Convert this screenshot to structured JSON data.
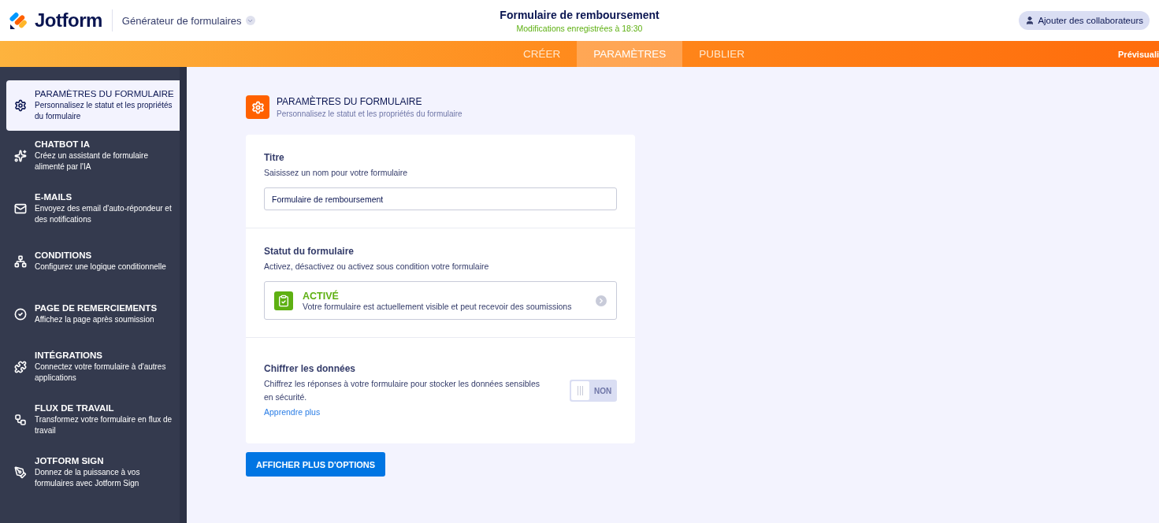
{
  "header": {
    "brand": "Jotform",
    "product_menu": "Générateur de formulaires",
    "title": "Formulaire de remboursement",
    "save_status": "Modifications enregistrées à 18:30",
    "collaborators_button": "Ajouter des collaborateurs"
  },
  "nav_tabs": [
    {
      "label": "CRÉER",
      "selected": false
    },
    {
      "label": "PARAMÈTRES",
      "selected": true
    },
    {
      "label": "PUBLIER",
      "selected": false
    }
  ],
  "preview_button": "Prévisuali",
  "sidebar": {
    "items": [
      {
        "title": "PARAMÈTRES DU FORMULAIRE",
        "description": "Personnalisez le statut et les propriétés du formulaire",
        "selected": true
      },
      {
        "title": "CHATBOT IA",
        "description": "Créez un assistant de formulaire alimenté par l'IA",
        "selected": false
      },
      {
        "title": "E-MAILS",
        "description": "Envoyez des email d'auto-répondeur et des notifications",
        "selected": false
      },
      {
        "title": "CONDITIONS",
        "description": "Configurez une logique conditionnelle",
        "selected": false
      },
      {
        "title": "PAGE DE REMERCIEMENTS",
        "description": "Affichez la page après soumission",
        "selected": false
      },
      {
        "title": "INTÉGRATIONS",
        "description": "Connectez votre formulaire à d'autres applications",
        "selected": false
      },
      {
        "title": "FLUX DE TRAVAIL",
        "description": "Transformez votre formulaire en flux de travail",
        "selected": false
      },
      {
        "title": "JOTFORM SIGN",
        "description": "Donnez de la puissance à vos formulaires avec Jotform Sign",
        "selected": false
      }
    ]
  },
  "section": {
    "title": "PARAMÈTRES DU FORMULAIRE",
    "subtitle": "Personnalisez le statut et les propriétés du formulaire"
  },
  "settings": [
    {
      "kind": "text",
      "label": "Titre",
      "description": "Saisissez un nom pour votre formulaire",
      "value": "Formulaire de remboursement"
    },
    {
      "kind": "status",
      "label": "Statut du formulaire",
      "description": "Activez, désactivez ou activez sous condition votre formulaire",
      "status": "ACTIVÉ",
      "status_description": "Votre formulaire est actuellement visible et peut recevoir des soumissions",
      "color": "#5eb012"
    },
    {
      "kind": "toggle",
      "label": "Chiffrer les données",
      "description": "Chiffrez les réponses à votre formulaire pour stocker les données sensibles en sécurité.",
      "link": "Apprendre plus",
      "on": false,
      "toggle_label": "NON"
    }
  ],
  "more_button": "AFFICHER PLUS D'OPTIONS"
}
